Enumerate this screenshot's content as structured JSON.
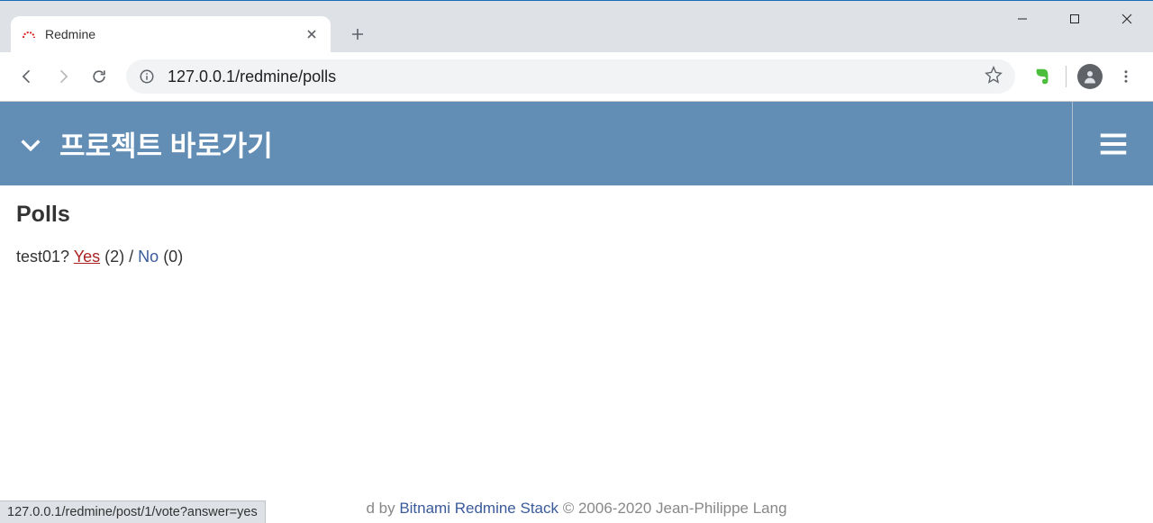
{
  "window": {
    "minimize_label": "Minimize",
    "maximize_label": "Maximize",
    "close_label": "Close"
  },
  "browser": {
    "tabs": [
      {
        "title": "Redmine",
        "favicon": "redmine"
      }
    ],
    "new_tab_label": "New Tab",
    "url": "127.0.0.1/redmine/polls",
    "back_label": "Back",
    "forward_label": "Forward",
    "reload_label": "Reload",
    "info_label": "Site information",
    "star_label": "Bookmark",
    "extension": {
      "name": "Evernote",
      "color": "#4bbf3c"
    },
    "profile_label": "Profile",
    "menu_label": "Menu"
  },
  "redmine": {
    "project_shortcut_title": "프로젝트 바로가기",
    "project_chevron_label": "Project dropdown",
    "hamburger_label": "Menu"
  },
  "page": {
    "title": "Polls"
  },
  "poll": {
    "question": "test01?",
    "yes_link": "Yes",
    "yes_count": "(2)",
    "separator": " / ",
    "no_link": "No",
    "no_count": "(0)"
  },
  "footer": {
    "d": "d",
    "by": " by ",
    "link": "Bitnami Redmine Stack",
    "copyright": " © 2006-2020 Jean-Philippe Lang"
  },
  "status_url": "127.0.0.1/redmine/post/1/vote?answer=yes"
}
